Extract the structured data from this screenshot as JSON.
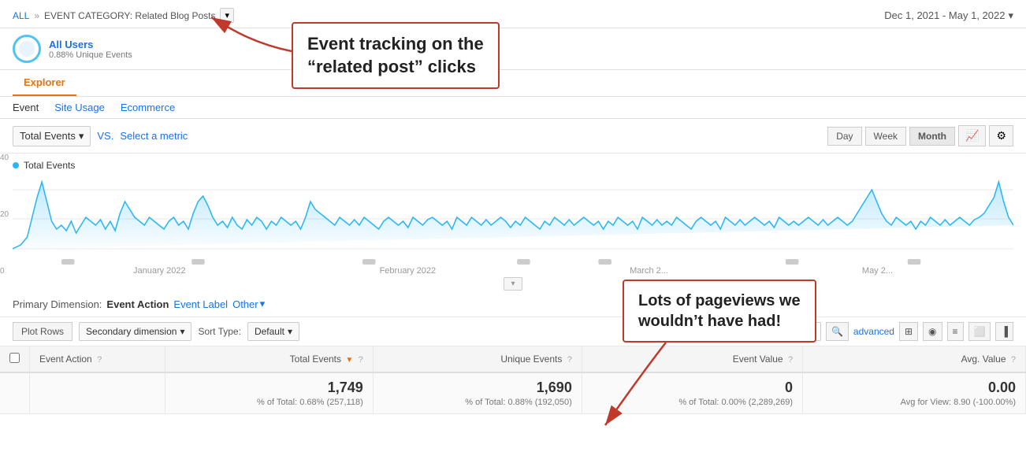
{
  "header": {
    "all_label": "ALL",
    "separator": "»",
    "filter_label": "EVENT CATEGORY: Related Blog Posts",
    "dropdown_char": "▾",
    "date_range": "Dec 1, 2021 - May 1, 2022",
    "date_arrow": "▾"
  },
  "segment": {
    "name": "All Users",
    "sub": "0.88% Unique Events"
  },
  "annotation1": {
    "line1": "Event tracking on the",
    "line2": "“related post” clicks"
  },
  "annotation2": {
    "line1": "Lots of pageviews we",
    "line2": "wouldn’t have had!"
  },
  "tabs": [
    {
      "label": "Explorer",
      "active": true
    }
  ],
  "sub_tabs": [
    {
      "label": "Event",
      "active": true
    },
    {
      "label": "Site Usage",
      "active": false
    },
    {
      "label": "Ecommerce",
      "active": false
    }
  ],
  "chart": {
    "metric_label": "Total Events",
    "metric_arrow": "▾",
    "vs_label": "VS.",
    "select_metric": "Select a metric",
    "period_buttons": [
      "Day",
      "Week",
      "Month"
    ],
    "active_period": "Month",
    "legend_label": "Total Events",
    "y_labels": [
      "40",
      "20",
      "0"
    ],
    "x_labels": [
      "January 2022",
      "February 2022",
      "March 2...",
      "May 2..."
    ]
  },
  "dimension": {
    "primary_label": "Primary Dimension:",
    "primary_value": "Event Action",
    "event_label_link": "Event Label",
    "other_label": "Other",
    "other_arrow": "▾"
  },
  "table_toolbar": {
    "plot_rows_label": "Plot Rows",
    "secondary_dim_label": "Secondary dimension",
    "secondary_dim_arrow": "▾",
    "sort_type_label": "Sort Type:",
    "sort_default_label": "Default",
    "sort_arrow": "▾",
    "search_placeholder": "",
    "advanced_label": "advanced"
  },
  "table": {
    "columns": [
      {
        "label": "",
        "type": "check"
      },
      {
        "label": "Event Action",
        "help": true,
        "sortable": false
      },
      {
        "label": "Total Events",
        "help": true,
        "sortable": true,
        "numeric": true
      },
      {
        "label": "Unique Events",
        "help": true,
        "sortable": false,
        "numeric": true
      },
      {
        "label": "Event Value",
        "help": true,
        "sortable": false,
        "numeric": true
      },
      {
        "label": "Avg. Value",
        "help": true,
        "sortable": false,
        "numeric": true
      }
    ],
    "totals": {
      "total_events": "1,749",
      "total_events_pct": "% of Total: 0.68% (257,118)",
      "unique_events": "1,690",
      "unique_events_pct": "% of Total: 0.88% (192,050)",
      "event_value": "0",
      "event_value_pct": "% of Total: 0.00% (2,289,269)",
      "avg_value": "0.00",
      "avg_value_pct": "Avg for View: 8.90 (-100.00%)"
    }
  }
}
